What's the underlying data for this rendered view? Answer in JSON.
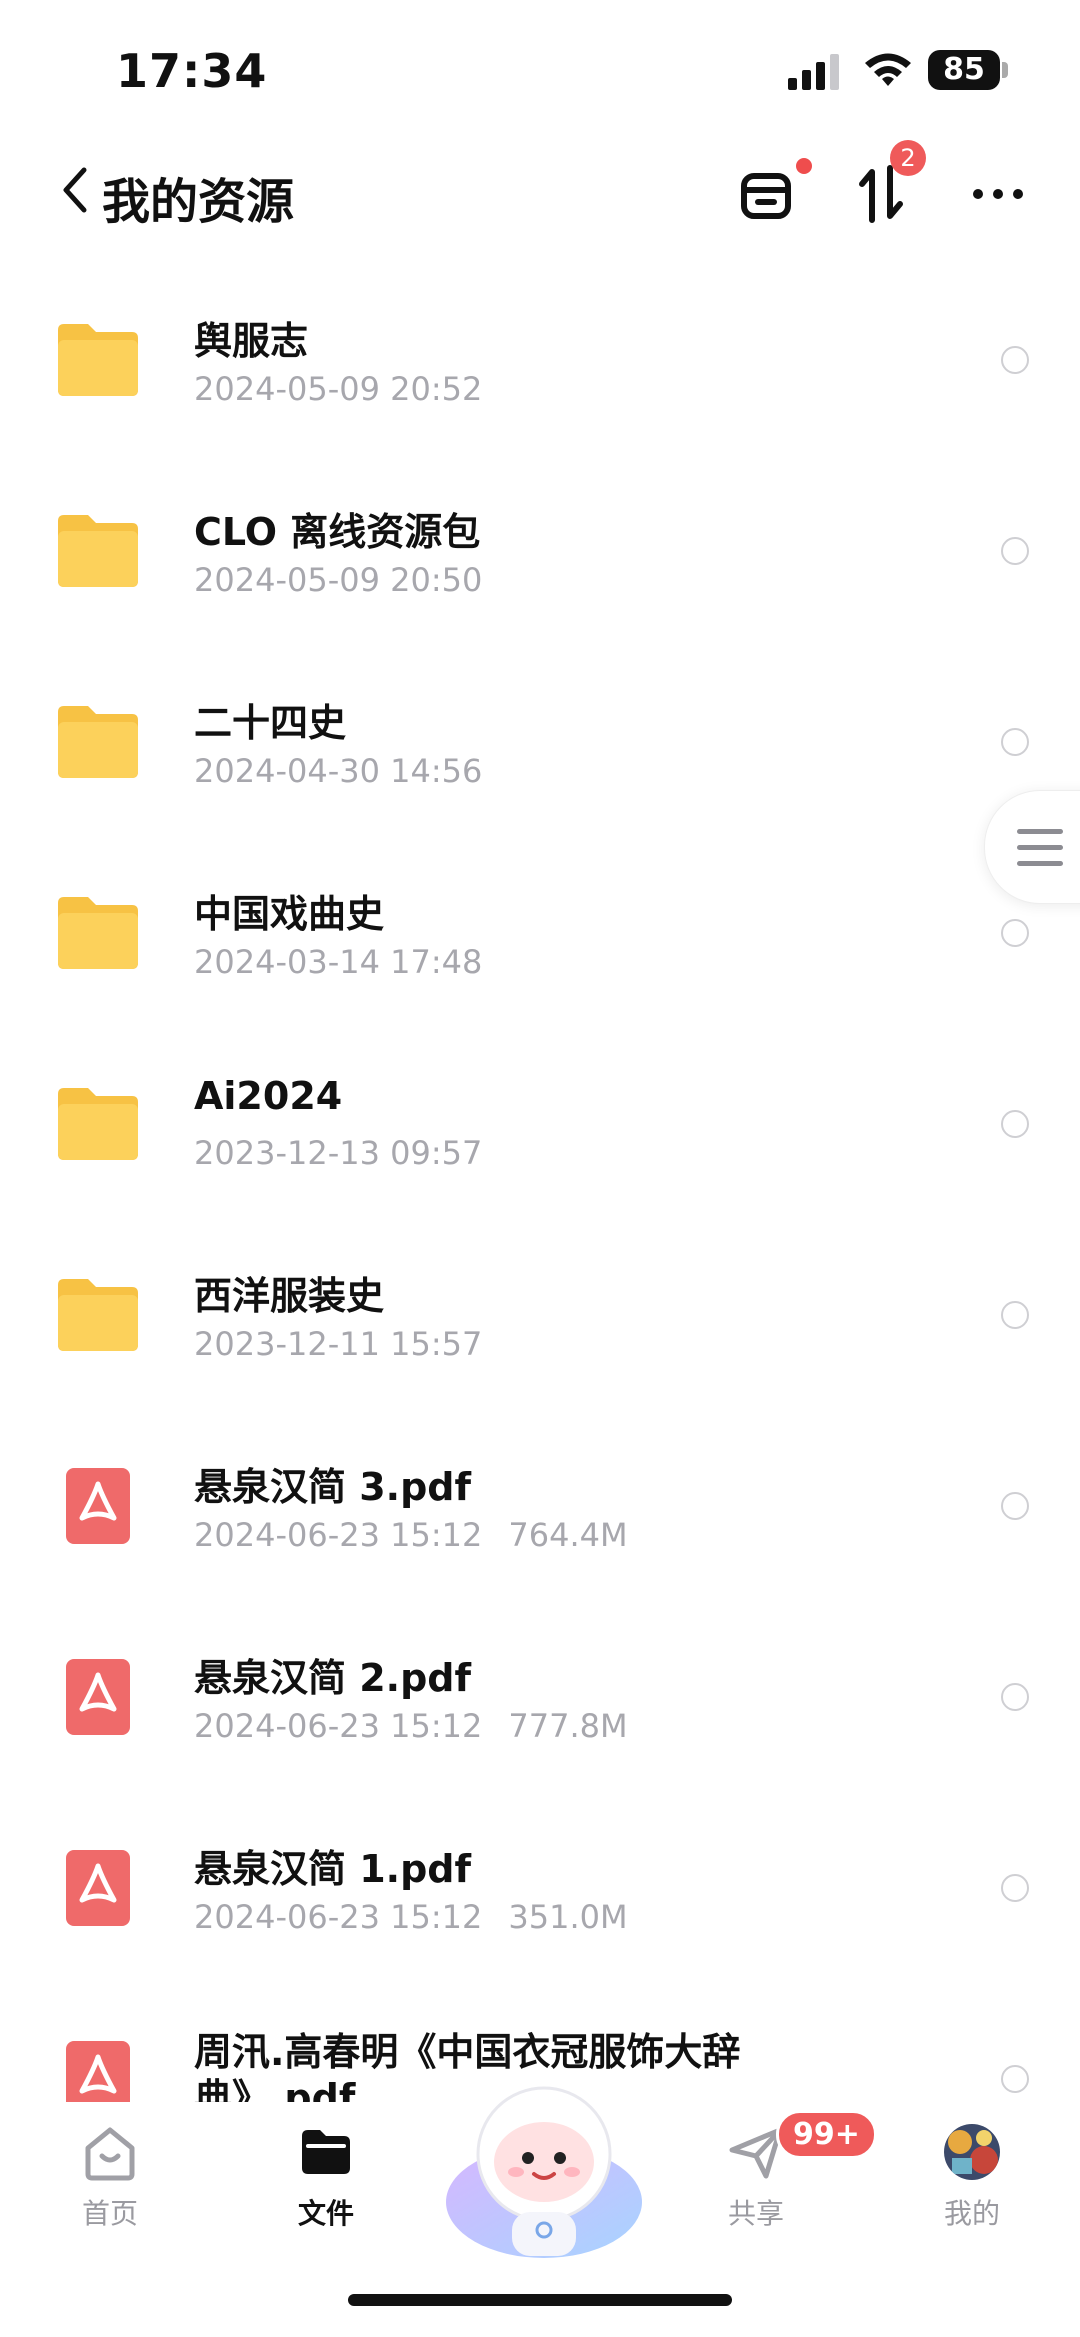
{
  "status_bar": {
    "time": "17:34",
    "battery": "85"
  },
  "header": {
    "title": "我的资源",
    "transfer_badge": "2"
  },
  "files": [
    {
      "name": "舆服志",
      "date": "2024-05-09 20:52",
      "size": "",
      "type": "folder"
    },
    {
      "name": "CLO 离线资源包",
      "date": "2024-05-09 20:50",
      "size": "",
      "type": "folder"
    },
    {
      "name": "二十四史",
      "date": "2024-04-30 14:56",
      "size": "",
      "type": "folder"
    },
    {
      "name": "中国戏曲史",
      "date": "2024-03-14 17:48",
      "size": "",
      "type": "folder"
    },
    {
      "name": "Ai2024",
      "date": "2023-12-13 09:57",
      "size": "",
      "type": "folder"
    },
    {
      "name": "西洋服装史",
      "date": "2023-12-11 15:57",
      "size": "",
      "type": "folder"
    },
    {
      "name": "悬泉汉简 3.pdf",
      "date": "2024-06-23 15:12",
      "size": "764.4M",
      "type": "pdf"
    },
    {
      "name": "悬泉汉简 2.pdf",
      "date": "2024-06-23 15:12",
      "size": "777.8M",
      "type": "pdf"
    },
    {
      "name": "悬泉汉简 1.pdf",
      "date": "2024-06-23 15:12",
      "size": "351.0M",
      "type": "pdf"
    },
    {
      "name": "周汛.高春明《中国衣冠服饰大辞典》.pdf",
      "date": "",
      "size": "",
      "type": "pdf"
    }
  ],
  "bottom_nav": {
    "home": "首页",
    "files": "文件",
    "share": "共享",
    "share_badge": "99+",
    "me": "我的"
  },
  "icons": {
    "folder_color": "#fcd15b",
    "pdf_color": "#ef6a6a",
    "badge_color": "#ef5a5a"
  }
}
